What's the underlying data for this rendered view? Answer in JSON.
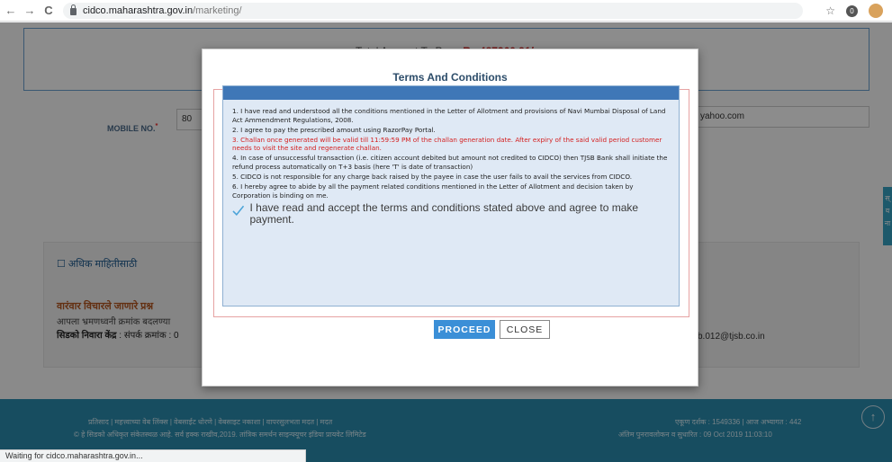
{
  "browser": {
    "url_host": "cidco.maharashtra.gov.in",
    "url_path": "/marketing/",
    "back": "←",
    "forward": "→",
    "reload": "C",
    "star": "☆",
    "ext": "0"
  },
  "page": {
    "total_label": "Total Amount To Pay : ",
    "total_amount": "Rs 487260.91/-",
    "mobile_label": "MOBILE NO.",
    "mobile_required": "*",
    "mobile_value": "80",
    "email_value": "yahoo.com",
    "side_tab_text": "स् य ना",
    "more_info": "अधिक माहितीसाठी",
    "faq_title": "वारंवार विचारले जाणारे प्रश्न",
    "faq_sub": "आपला भ्रमणध्वनी क्रमांक बदलण्या",
    "helpline_bold": "सिडको निवारा केंद्र",
    "helpline_text": " : संपर्क क्रमांक : 0",
    "email_tail": "b.012@tjsb.co.in",
    "footer_links": "प्रतिसाद | महत्त्वाच्या वेब लिंक्स | वेबसाईट धोरणे | वेबसाइट नकाशा | वापरसुलभता मदत | मदत",
    "footer_copy": "© हे सिडको अधिकृत संकेतस्थळ आहे. सर्व हक्क राखीव,2019. तांत्रिक समर्थन साइन्फ्यूचर इंडिया प्रायवेट लिमिटेड",
    "footer_counter": "एकूण दर्शक : 1549336 | आज अभ्यागत : 442",
    "footer_updated": "अंतिम पुनरावलोकन व सुधारित : 09 Oct 2019 11:03:10",
    "scroll_top": "↑"
  },
  "modal": {
    "title": "Terms And Conditions",
    "terms": [
      {
        "text": "1. I have read and understood all the conditions mentioned in the Letter of Allotment and provisions of Navi Mumbai Disposal of Land Act Ammendment Regulations, 2008.",
        "warn": false
      },
      {
        "text": "2. I agree to pay the prescribed amount using RazorPay Portal.",
        "warn": false
      },
      {
        "text": "3. Challan once generated will be valid till 11:59:59 PM of the challan generation date. After expiry of the said valid period customer needs to visit the site and regenerate challan.",
        "warn": true
      },
      {
        "text": "4. In case of unsuccessful transaction (i.e. citizen account debited but amount not credited to CIDCO) then TJSB Bank shall initiate the refund process automatically on T+3 basis (here 'T' is date of transaction)",
        "warn": false
      },
      {
        "text": "5. CIDCO is not responsible for any charge back raised by the payee in case the user fails to avail the services from CIDCO.",
        "warn": false
      },
      {
        "text": "6. I hereby agree to abide by all the payment related conditions mentioned in the Letter of Allotment and decision taken by Corporation is binding on me.",
        "warn": false
      }
    ],
    "accept_text": "I have read and accept the terms and conditions stated above and agree to make payment.",
    "accept_checked": true,
    "proceed_label": "PROCEED",
    "close_label": "CLOSE"
  },
  "status_bar": "Waiting for cidco.maharashtra.gov.in...",
  "colors": {
    "proceed": "#3b8fd7",
    "modal_header": "#3f77b7",
    "warn_text": "#d42020",
    "footer": "#2a8cb0"
  }
}
